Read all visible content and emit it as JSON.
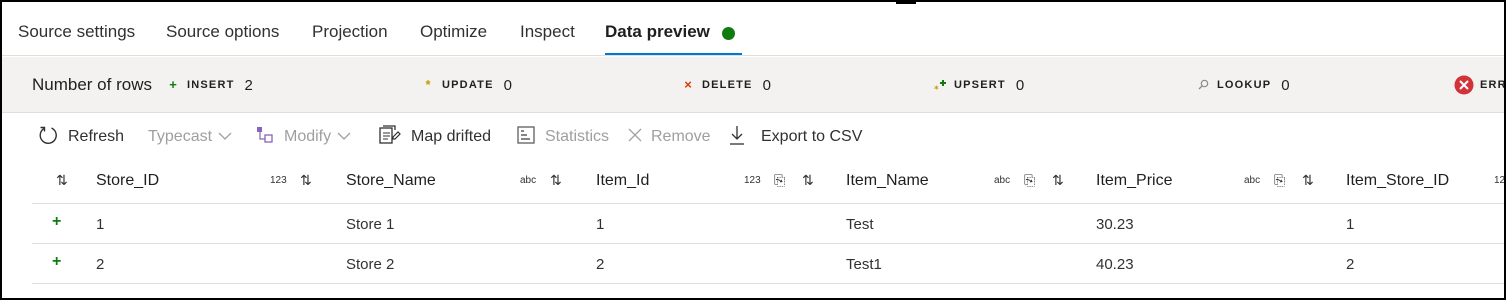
{
  "tabs": [
    {
      "label": "Source settings"
    },
    {
      "label": "Source options"
    },
    {
      "label": "Projection"
    },
    {
      "label": "Optimize"
    },
    {
      "label": "Inspect"
    },
    {
      "label": "Data preview"
    }
  ],
  "active_tab": "Data preview",
  "status_color": "#107c10",
  "counts": {
    "label": "Number of rows",
    "items": [
      {
        "name": "INSERT",
        "value": "2",
        "icon": "plus-icon",
        "color": "#107c10"
      },
      {
        "name": "UPDATE",
        "value": "0",
        "icon": "asterisk-icon",
        "color": "#c19c00"
      },
      {
        "name": "DELETE",
        "value": "0",
        "icon": "x-icon",
        "color": "#d83b01"
      },
      {
        "name": "UPSERT",
        "value": "0",
        "icon": "upsert-icon",
        "color": "#107c10"
      },
      {
        "name": "LOOKUP",
        "value": "0",
        "icon": "search-icon",
        "color": "#605e5c"
      },
      {
        "name": "ERRO",
        "value": "",
        "icon": "error-icon",
        "color": "#d13438"
      }
    ]
  },
  "toolbar": {
    "refresh": "Refresh",
    "typecast": "Typecast",
    "modify": "Modify",
    "map_drifted": "Map drifted",
    "statistics": "Statistics",
    "remove": "Remove",
    "export": "Export to CSV"
  },
  "table": {
    "columns": [
      {
        "name": "Store_ID",
        "type": "123"
      },
      {
        "name": "Store_Name",
        "type": "abc"
      },
      {
        "name": "Item_Id",
        "type": "123"
      },
      {
        "name": "Item_Name",
        "type": "abc"
      },
      {
        "name": "Item_Price",
        "type": "abc"
      },
      {
        "name": "Item_Store_ID",
        "type": "12"
      }
    ],
    "rows": [
      [
        "1",
        "Store 1",
        "1",
        "Test",
        "30.23",
        "1"
      ],
      [
        "2",
        "Store 2",
        "2",
        "Test1",
        "40.23",
        "2"
      ]
    ]
  }
}
